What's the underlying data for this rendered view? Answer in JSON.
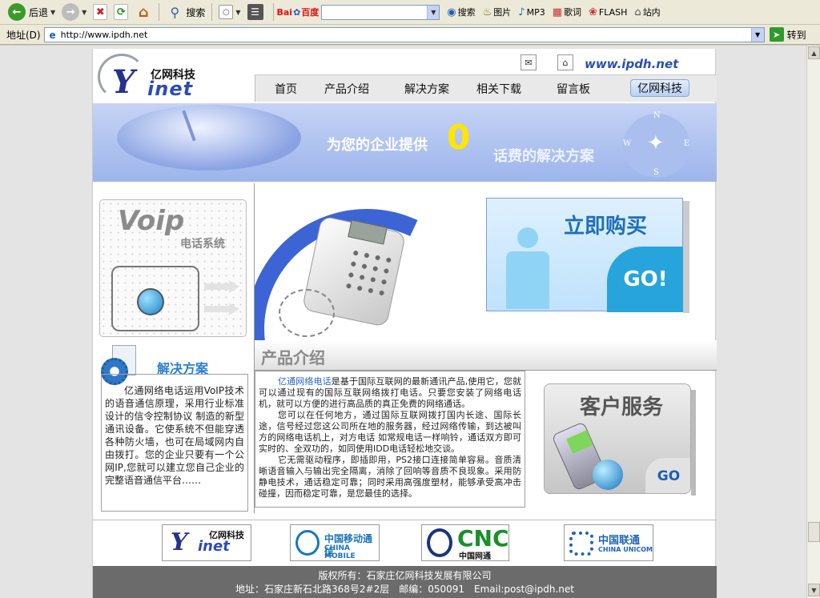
{
  "toolbar": {
    "back_label": "后退",
    "search_label": "搜索",
    "baidu_logo": "Bai",
    "baidu_logo_suffix": "百度",
    "baidu_items": [
      "搜索",
      "图片",
      "MP3",
      "歌词",
      "FLASH",
      "站内"
    ]
  },
  "address": {
    "label": "地址(D)",
    "url": "http://www.ipdh.net",
    "go_label": "转到"
  },
  "site": {
    "logo_cn": "亿网科技",
    "logo_en": "inet",
    "logo_y": "Y",
    "url_text": "www.ipdh.net",
    "nav": [
      "首页",
      "产品介绍",
      "解决方案",
      "相关下载",
      "留言板"
    ],
    "nav_active": "亿网科技"
  },
  "banner": {
    "part1": "为您的企业提供",
    "zero": "0",
    "part2": "话费的解决方案",
    "compass": {
      "n": "N",
      "e": "E",
      "s": "S",
      "w": "W"
    }
  },
  "voip": {
    "logo": "Voip",
    "subtitle": "电话系统"
  },
  "solution": {
    "title": "解决方案",
    "text": "亿通网络电话运用VoIP技术的语音通信原理，采用行业标准设计的信令控制协议 制造的新型通讯设备。它使系统不但能穿透各种防火墙，也可在局域网内自由拨打。您的企业只要有一个公网IP,您就可以建立您自己企业的完整语音通信平台……"
  },
  "buy": {
    "title": "立即购买",
    "go": "GO!"
  },
  "product": {
    "title": "产品介绍",
    "highlight": "亿通网络电话",
    "p1_rest": "是基于国际互联网的最新通讯产品,使用它，您就可以通过现有的国际互联网络拨打电话。只要您安装了网络电话机，就可以方便的进行高品质的真正免费的网络通话。",
    "p2": "您可以在任何地方，通过国际互联网拨打国内长途、国际长途，信号经过您这公司所在地的服务器，经过网络传输，到达被叫方的网络电话机上，对方电话 如常规电话一样响铃，通话双方即可实时的、全双功的，如同使用IDD电话轻松地交谈。",
    "p3": "它无需驱动程序，即插即用，PS2接口连接简单容易。音质清晰语音输入与输出完全隔离，消除了回响等音质不良现象。采用防静电技术，通话稳定可靠；同时采用高强度塑材，能够承受高冲击碰撞，因而稳定可靠，是您最佳的选择。"
  },
  "service": {
    "title": "客户服务",
    "go": "GO"
  },
  "partners": {
    "inet_cn": "亿网科技",
    "inet_en": "inet",
    "inet_y": "Y",
    "cm_cn": "中国移动通信",
    "cm_en": "CHINA MOBILE",
    "cnc_en": "CNC",
    "cnc_cn": "中国网通",
    "cu_cn": "中国联通",
    "cu_en": "CHINA UNICOM"
  },
  "footer": {
    "line1": "版权所有：石家庄亿网科技发展有限公司",
    "line2": "地址：石家庄新石北路368号2#2层　邮编：050091　Email:post@ipdh.net"
  }
}
